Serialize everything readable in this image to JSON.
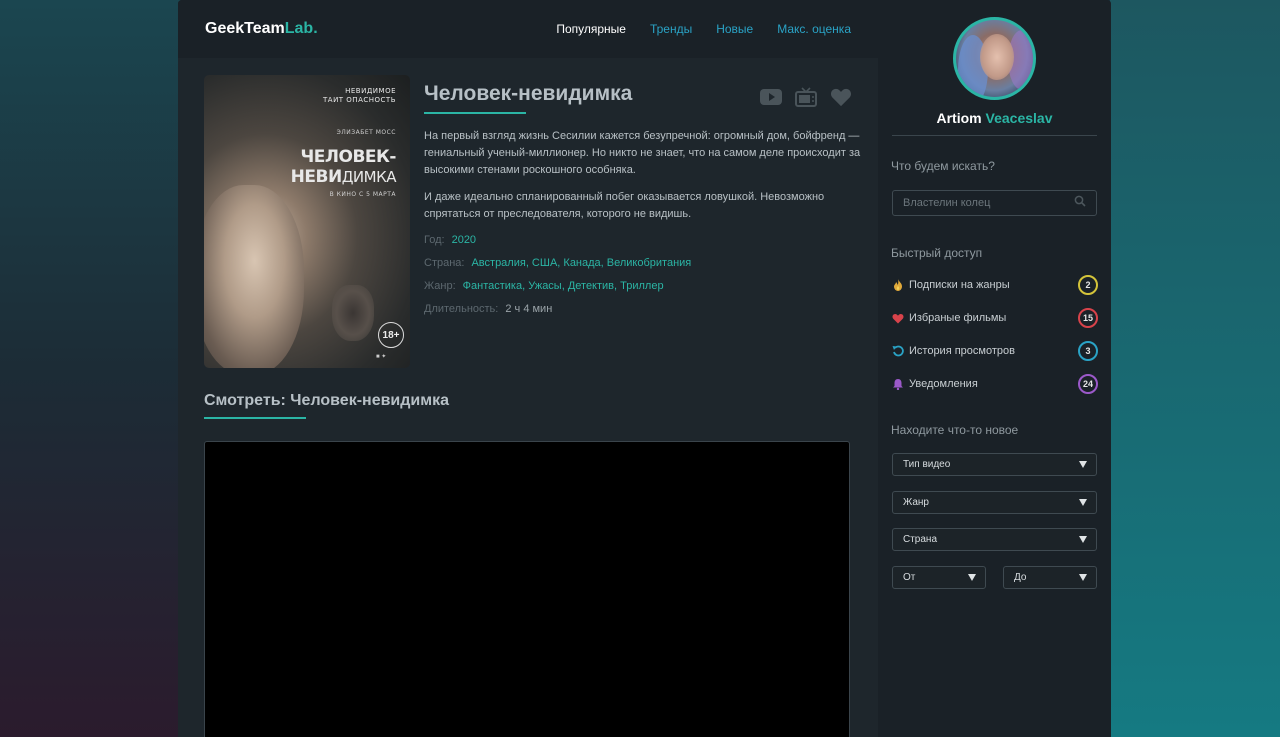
{
  "header": {
    "logo_main": "GeekTeam",
    "logo_accent": "Lab.",
    "nav": [
      {
        "label": "Популярные",
        "active": true
      },
      {
        "label": "Тренды",
        "active": false
      },
      {
        "label": "Новые",
        "active": false
      },
      {
        "label": "Макс. оценка",
        "active": false
      }
    ]
  },
  "poster": {
    "tagline_line1": "НЕВИДИМОЕ",
    "tagline_line2": "ТАИТ ОПАСНОСТЬ",
    "actor": "ЭЛИЗАБЕТ МОСС",
    "title_line1": "ЧЕЛОВЕК-",
    "title_line2_bold": "НЕВИ",
    "title_line2_rest": "ДИМКА",
    "release": "В КИНО С 5 МАРТА",
    "age": "18+"
  },
  "movie": {
    "title": "Человек-невидимка",
    "description": [
      "На первый взгляд жизнь Сесилии кажется безупречной: огромный дом, бойфренд — гениальный ученый-миллионер. Но никто не знает, что на самом деле происходит за высокими стенами роскошного особняка.",
      "И даже идеально спланированный побег оказывается ловушкой. Невозможно спрятаться от преследователя, которого не видишь."
    ],
    "meta": {
      "year_label": "Год:",
      "year": "2020",
      "country_label": "Страна:",
      "country": "Австралия, США, Канада, Великобритания",
      "genre_label": "Жанр:",
      "genre": "Фантастика, Ужасы, Детектив, Триллер",
      "duration_label": "Длительность:",
      "duration": "2 ч 4 мин"
    },
    "actions": [
      {
        "icon": "youtube-icon"
      },
      {
        "icon": "tv-icon"
      },
      {
        "icon": "heart-icon"
      }
    ]
  },
  "watch": {
    "title": "Смотреть: Человек-невидимка"
  },
  "sidebar": {
    "user_first": "Artiom",
    "user_last": "Veaceslav",
    "search_title": "Что будем искать?",
    "search_placeholder": "Властелин колец",
    "quick_title": "Быстрый доступ",
    "quick": [
      {
        "label": "Подписки на жанры",
        "count": "2",
        "color": "#d4c43a",
        "icon": "fire-icon"
      },
      {
        "label": "Избраные фильмы",
        "count": "15",
        "color": "#d8434b",
        "icon": "heart-icon"
      },
      {
        "label": "История просмотров",
        "count": "3",
        "color": "#2aa3c6",
        "icon": "history-icon"
      },
      {
        "label": "Уведомления",
        "count": "24",
        "color": "#9b59c9",
        "icon": "bell-icon"
      }
    ],
    "discover_title": "Находите что-то новое",
    "filters": {
      "type": "Тип видео",
      "genre": "Жанр",
      "country": "Страна",
      "from": "От",
      "to": "До"
    }
  },
  "colors": {
    "accent": "#2bb5a5",
    "link": "#2aa3c6"
  }
}
